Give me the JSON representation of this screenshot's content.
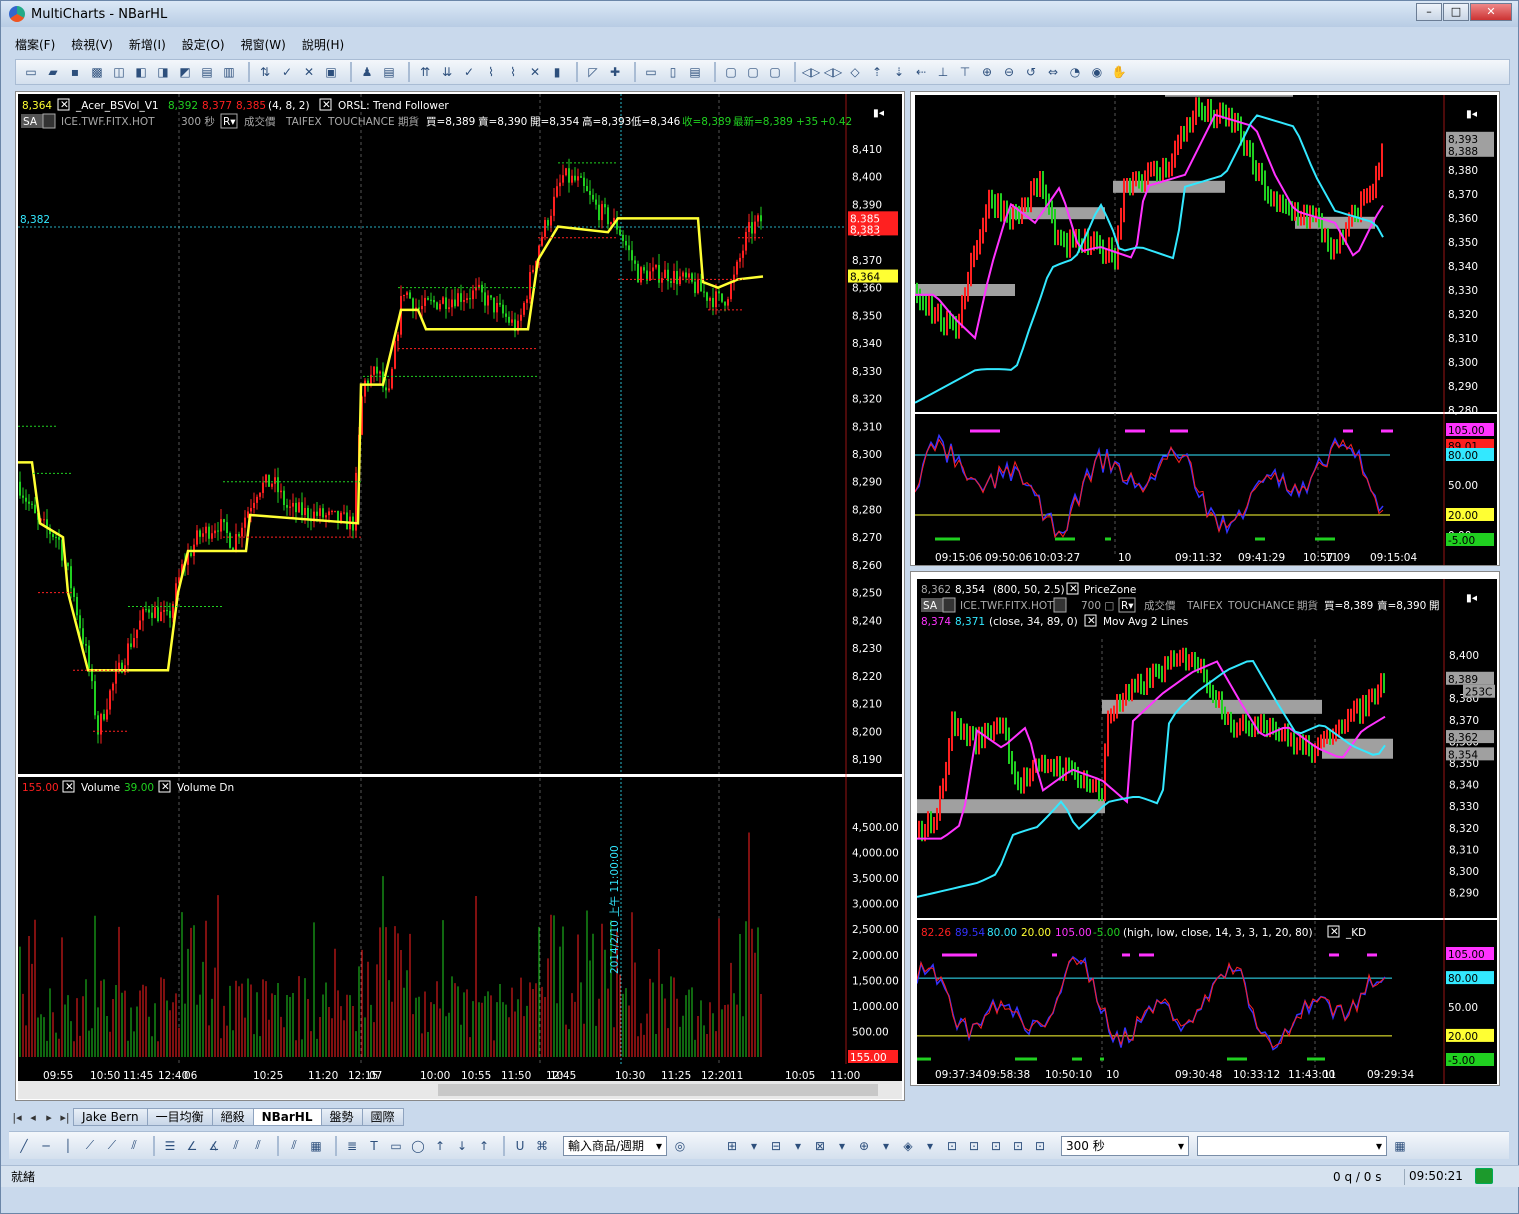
{
  "window": {
    "title": "MultiCharts - NBarHL"
  },
  "menu": [
    "檔案(F)",
    "檢視(V)",
    "新增(I)",
    "設定(O)",
    "視窗(W)",
    "說明(H)"
  ],
  "left_chart": {
    "header_line1": {
      "value1": "8,364",
      "name": "_Acer_BSVol_V1",
      "v2": "8,392",
      "v3": "8,377",
      "v4": "8,385",
      "params": "(4,  8,  2)",
      "signal": "ORSL: Trend Follower"
    },
    "header_line2": {
      "badge": "SA",
      "symbol": "ICE.TWF.FITX.HOT",
      "interval": "300 秒",
      "field": "成交價",
      "exchange": "TAIFEX",
      "source": "TOUCHANCE",
      "type": "期貨",
      "bid": "買=8,389",
      "ask": "賣=8,390",
      "open": "開=8,354",
      "high": "高=8,393",
      "low": "低=8,346",
      "close": "收=8,389",
      "last": "最新=8,389",
      "chg": "+35",
      "pct": "+0.42"
    },
    "crosshair_label": "8,382",
    "price_ticks": [
      "8,410",
      "8,400",
      "8,390",
      "8,380",
      "8,370",
      "8,360",
      "8,350",
      "8,340",
      "8,330",
      "8,320",
      "8,310",
      "8,300",
      "8,290",
      "8,280",
      "8,270",
      "8,260",
      "8,250",
      "8,240",
      "8,230",
      "8,220",
      "8,210",
      "8,200",
      "8,190"
    ],
    "price_markers": {
      "red1": "8,385",
      "red2": "8,383",
      "yellow": "8,364"
    },
    "volume_header": {
      "v1": "155.00",
      "name1": "Volume",
      "v2": "39.00",
      "name2": "Volume Dn"
    },
    "volume_ticks": [
      "4,500.00",
      "4,000.00",
      "3,500.00",
      "3,000.00",
      "2,500.00",
      "2,000.00",
      "1,500.00",
      "1,000.00",
      "500.00"
    ],
    "volume_marker": "155.00",
    "vertical_cursor_label": "2014/2/10 上午 11:00:00",
    "time_ticks": [
      "09:55",
      "10:50",
      "11:45",
      "12:40",
      "06",
      "10:25",
      "11:20",
      "12:15",
      "07",
      "10:00",
      "10:55",
      "11:50",
      "12:45",
      "10",
      "10:30",
      "11:25",
      "12:20",
      "11",
      "10:05",
      "11:00"
    ]
  },
  "right_top_chart": {
    "price_ticks": [
      "8,380",
      "8,370",
      "8,360",
      "8,350",
      "8,340",
      "8,330",
      "8,320",
      "8,310",
      "8,300",
      "8,290",
      "8,280"
    ],
    "price_markers": {
      "m1": "8,393",
      "m2": "8,388"
    },
    "kd_markers": {
      "magenta": "105.00",
      "red": "89.01",
      "cyan": "80.00",
      "yellow": "20.00",
      "green": "-5.00"
    },
    "kd_ticks": [
      "50.00",
      "0.00"
    ],
    "time_ticks": [
      "09:15:06",
      "09:50:06",
      "10:03:27",
      "10",
      "09:11:32",
      "09:41:29",
      "10:57:09",
      "11",
      "09:15:04"
    ]
  },
  "right_bottom_chart": {
    "header_line1": {
      "v1": "8,362",
      "v2": "8,354",
      "params": "(800,  50,  2.5)",
      "name": "PriceZone"
    },
    "header_line2": {
      "badge": "SA",
      "symbol": "ICE.TWF.FITX.HOT",
      "interval": "700 □",
      "field": "成交價",
      "exchange": "TAIFEX",
      "source": "TOUCHANCE",
      "type": "期貨",
      "bid": "買=8,389",
      "ask": "賣=8,390",
      "open": "開"
    },
    "header_line3": {
      "v1": "8,374",
      "v2": "8,371",
      "params": "(close,  34,  89,  0)",
      "name": "Mov Avg 2 Lines"
    },
    "price_ticks": [
      "8,400",
      "8,390",
      "8,380",
      "8,370",
      "8,360",
      "8,350",
      "8,340",
      "8,330",
      "8,320",
      "8,310",
      "8,300",
      "8,290"
    ],
    "price_markers": {
      "m1": "8,389",
      "m2": "253C",
      "m3": "8,362",
      "m4": "8,354"
    },
    "kd_header": {
      "v1": "82.26",
      "v2": "89.54",
      "v3": "80.00",
      "v4": "20.00",
      "v5": "105.00",
      "v6": "-5.00",
      "params": "(high,  low,  close,  14,  3,  3,  1,  20,  80)",
      "name": "_KD"
    },
    "kd_markers": {
      "magenta": "105.00",
      "cyan": "80.00",
      "yellow": "20.00",
      "green": "-5.00"
    },
    "kd_ticks": [
      "50.00"
    ],
    "time_ticks": [
      "09:37:34",
      "09:58:38",
      "10:50:10",
      "10",
      "09:30:48",
      "10:33:12",
      "11:43:00",
      "11",
      "09:29:34"
    ]
  },
  "tabs": [
    "Jake Bern",
    "一目均衡",
    "絕殺",
    "NBarHL",
    "盤勢",
    "國際"
  ],
  "active_tab": "NBarHL",
  "drawbar": {
    "symbol_combo": "輸入商品/週期",
    "interval_combo": "300 秒"
  },
  "status": {
    "left": "就緒",
    "queue": "0 q / 0 s",
    "time": "09:50:21"
  },
  "colors": {
    "bg": "#000000",
    "up": "#ff2020",
    "down": "#20d020",
    "trend": "#ffff33",
    "ma_fast": "#ff33ff",
    "ma_slow": "#33e8ff",
    "zone": "#a0a0a0"
  }
}
